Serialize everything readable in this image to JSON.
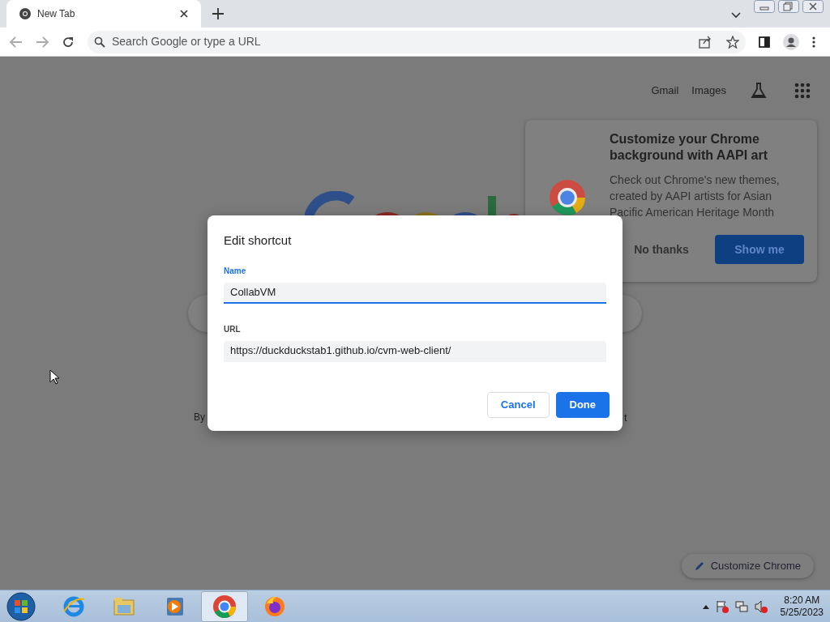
{
  "browser": {
    "tabs": [
      {
        "title": "New Tab",
        "selected": true
      }
    ],
    "omnibox": {
      "placeholder": "Search Google or type a URL"
    }
  },
  "ntp": {
    "header_links": [
      "Gmail",
      "Images"
    ],
    "fragments": [
      "By",
      "t"
    ],
    "promo": {
      "title": "Customize your Chrome background with AAPI art",
      "body": "Check out Chrome's new themes, created by AAPI artists for Asian Pacific American Heritage Month",
      "buttons": [
        {
          "label": "No thanks",
          "kind": "text"
        },
        {
          "label": "Show me",
          "kind": "primary"
        }
      ]
    },
    "customize_button": "Customize Chrome"
  },
  "dialog": {
    "title": "Edit shortcut",
    "fields": [
      {
        "label": "Name",
        "value": "CollabVM",
        "focused": true
      },
      {
        "label": "URL",
        "value": "https://duckduckstab1.github.io/cvm-web-client/",
        "focused": false
      }
    ],
    "buttons": [
      {
        "label": "Cancel",
        "kind": "secondary"
      },
      {
        "label": "Done",
        "kind": "primary"
      }
    ]
  },
  "taskbar": {
    "apps": [
      {
        "kind": "ie",
        "selected": false
      },
      {
        "kind": "explorer",
        "selected": false
      },
      {
        "kind": "media",
        "selected": false
      },
      {
        "kind": "chrome",
        "selected": true
      },
      {
        "kind": "firefox",
        "selected": false
      }
    ],
    "clock": {
      "time": "8:20 AM",
      "date": "5/25/2023"
    }
  }
}
